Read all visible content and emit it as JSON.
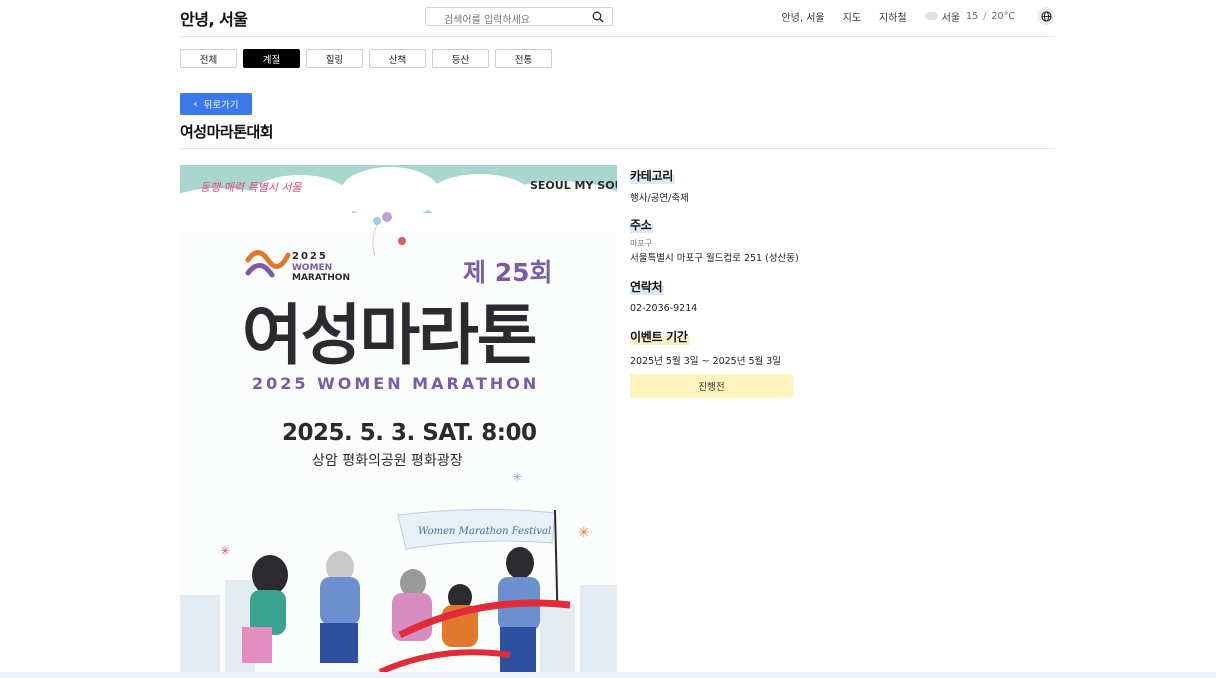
{
  "header": {
    "logo": "안녕, 서울",
    "search_placeholder": "검색어를 입력하세요",
    "nav": [
      "안녕, 서울",
      "지도",
      "지하철"
    ],
    "weather": {
      "city": "서울",
      "low": "15",
      "high": "20°C"
    }
  },
  "tabs": [
    {
      "label": "전체",
      "active": false
    },
    {
      "label": "계절",
      "active": true
    },
    {
      "label": "힐링",
      "active": false
    },
    {
      "label": "산책",
      "active": false
    },
    {
      "label": "등산",
      "active": false
    },
    {
      "label": "전통",
      "active": false
    }
  ],
  "back_label": "뒤로가기",
  "page_title": "여성마라톤대회",
  "poster": {
    "top_left_script": "동행·매력 특별시 서울",
    "brand": "SEOUL MY SOUL",
    "logo_year": "2025",
    "logo_line1": "WOMEN",
    "logo_line2": "MARATHON",
    "edition": "제 25회",
    "headline": "여성마라톤",
    "subtitle": "2025 WOMEN MARATHON",
    "datetime": "2025. 5. 3. SAT. 8:00",
    "venue": "상암 평화의공원 평화광장",
    "flag_text": "Women Marathon Festival"
  },
  "info": {
    "category_label": "카테고리",
    "category_value": "행사/공연/축제",
    "address_label": "주소",
    "district": "마포구",
    "address": "서울특별시 마포구 월드컵로 251 (성산동)",
    "contact_label": "연락처",
    "phone": "02-2036-9214",
    "period_label": "이벤트 기간",
    "period": "2025년 5월 3일 ~ 2025년 5월 3일",
    "status": "진행전"
  },
  "colors": {
    "accent": "#3b78ef",
    "status_bg": "#fcf3bd",
    "poster_headline": "#2b2a2f",
    "poster_subtitle": "#7b5aa6",
    "poster_teal": "#a9d7cf"
  }
}
